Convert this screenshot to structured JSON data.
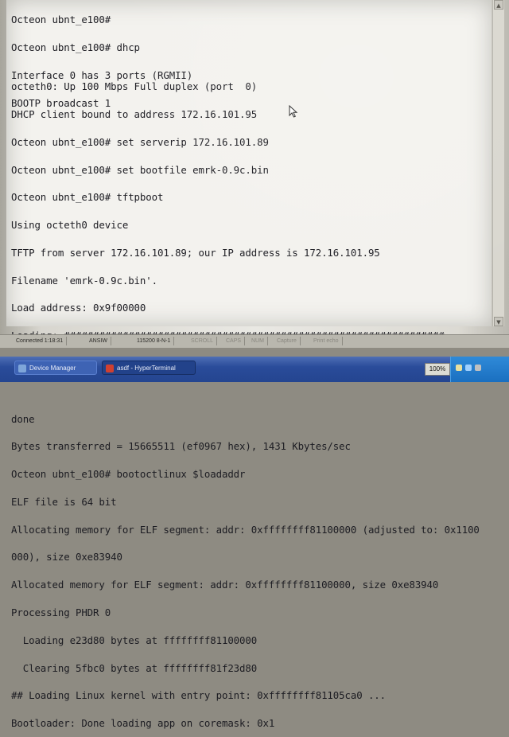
{
  "terminal": {
    "top_lines": [
      "Octeon ubnt_e100#",
      "Octeon ubnt_e100# dhcp",
      "Interface 0 has 3 ports (RGMII)",
      "BOOTP broadcast 1"
    ],
    "main_lines": [
      "octeth0: Up 100 Mbps Full duplex (port  0)",
      "DHCP client bound to address 172.16.101.95",
      "Octeon ubnt_e100# set serverip 172.16.101.89",
      "Octeon ubnt_e100# set bootfile emrk-0.9c.bin",
      "Octeon ubnt_e100# tftpboot",
      "Using octeth0 device",
      "TFTP from server 172.16.101.89; our IP address is 172.16.101.95",
      "Filename 'emrk-0.9c.bin'.",
      "Load address: 0x9f00000",
      "Loading: #################################################################",
      "         ##################################################",
      "",
      "done",
      "Bytes transferred = 15665511 (ef0967 hex), 1431 Kbytes/sec",
      "Octeon ubnt_e100# bootoctlinux $loadaddr",
      "ELF file is 64 bit",
      "Allocating memory for ELF segment: addr: 0xffffffff81100000 (adjusted to: 0x1100",
      "000), size 0xe83940",
      "Allocated memory for ELF segment: addr: 0xffffffff81100000, size 0xe83940",
      "Processing PHDR 0",
      "  Loading e23d80 bytes at ffffffff81100000",
      "  Clearing 5fbc0 bytes at ffffffff81f23d80",
      "## Loading Linux kernel with entry point: 0xffffffff81105ca0 ...",
      "Bootloader: Done loading app on coremask: 0x1"
    ]
  },
  "statusbar": {
    "connected": "Connected 1:18:31",
    "emulation": "ANSIW",
    "port_settings": "115200 8-N-1",
    "scroll": "SCROLL",
    "caps": "CAPS",
    "num": "NUM",
    "capture": "Capture",
    "print_echo": "Print echo"
  },
  "taskbar": {
    "buttons": [
      {
        "label": "Device Manager",
        "icon_color": "#7fa6d9",
        "icon": "device-manager-icon"
      },
      {
        "label": "asdf - HyperTerminal",
        "icon_color": "#d04030",
        "icon": "hyperterminal-icon"
      }
    ],
    "zoom": "100%"
  }
}
